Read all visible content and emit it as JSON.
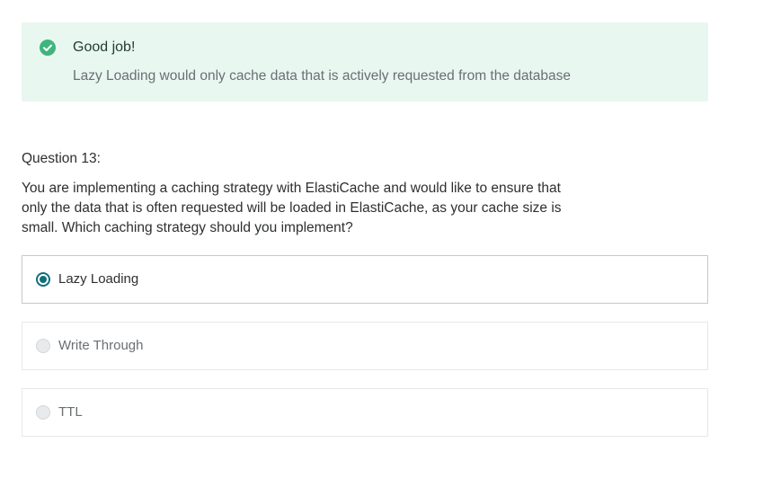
{
  "feedback": {
    "status_icon": "check-circle-icon",
    "status_color": "#3fb57e",
    "title": "Good job!",
    "explanation": "Lazy Loading would only cache data that is actively requested from the database"
  },
  "question": {
    "number_label": "Question 13:",
    "text": "You are implementing a caching strategy with ElastiCache and would like to ensure that only the data that is often requested will be loaded in ElastiCache, as your cache size is small. Which caching strategy should you implement?"
  },
  "options": [
    {
      "label": "Lazy Loading",
      "selected": true
    },
    {
      "label": "Write Through",
      "selected": false
    },
    {
      "label": "TTL",
      "selected": false
    }
  ],
  "colors": {
    "accent": "#0f6f7c",
    "feedback_background": "#e9f7f1"
  }
}
